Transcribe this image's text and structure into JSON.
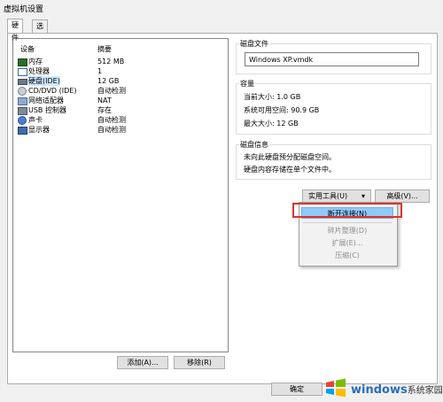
{
  "window": {
    "title": "虚拟机设置"
  },
  "tabs": [
    {
      "label": "硬件"
    },
    {
      "label": "选项"
    }
  ],
  "devices": {
    "header_device": "设备",
    "header_summary": "摘要",
    "rows": [
      {
        "name": "内存",
        "summary": "512 MB",
        "icon": "memory-icon"
      },
      {
        "name": "处理器",
        "summary": "1",
        "icon": "cpu-icon"
      },
      {
        "name": "硬盘(IDE)",
        "summary": "12 GB",
        "icon": "hard-disk-icon"
      },
      {
        "name": "CD/DVD (IDE)",
        "summary": "自动检测",
        "icon": "cd-dvd-icon"
      },
      {
        "name": "网络适配器",
        "summary": "NAT",
        "icon": "network-adapter-icon"
      },
      {
        "name": "USB 控制器",
        "summary": "存在",
        "icon": "usb-icon"
      },
      {
        "name": "声卡",
        "summary": "自动检测",
        "icon": "sound-card-icon"
      },
      {
        "name": "显示器",
        "summary": "自动检测",
        "icon": "display-icon"
      }
    ],
    "add_button": "添加(A)...",
    "remove_button": "移除(R)"
  },
  "disk_file": {
    "label": "磁盘文件",
    "value": "Windows XP.vmdk"
  },
  "capacity": {
    "label": "容量",
    "current_size": "当前大小: 1.0 GB",
    "system_free": "系统可用空间: 90.9 GB",
    "max_size": "最大大小: 12 GB"
  },
  "disk_info": {
    "label": "磁盘信息",
    "line1": "未向此硬盘预分配磁盘空间。",
    "line2": "硬盘内容存储在单个文件中。"
  },
  "buttons": {
    "utilities": "实用工具(U)",
    "advanced": "高级(V)...",
    "ok": "确定"
  },
  "utilities_menu": {
    "items": [
      {
        "label": "断开连接(N)"
      },
      {
        "label": "碎片整理(D)"
      },
      {
        "label": "扩展(E)..."
      },
      {
        "label": "压缩(C)"
      }
    ]
  },
  "watermark": {
    "brand": "windows",
    "suffix": "系统家园"
  },
  "colors": {
    "highlight": "#e03030",
    "selection": "#cce8ff",
    "menu_hover": "#91c9f7"
  }
}
